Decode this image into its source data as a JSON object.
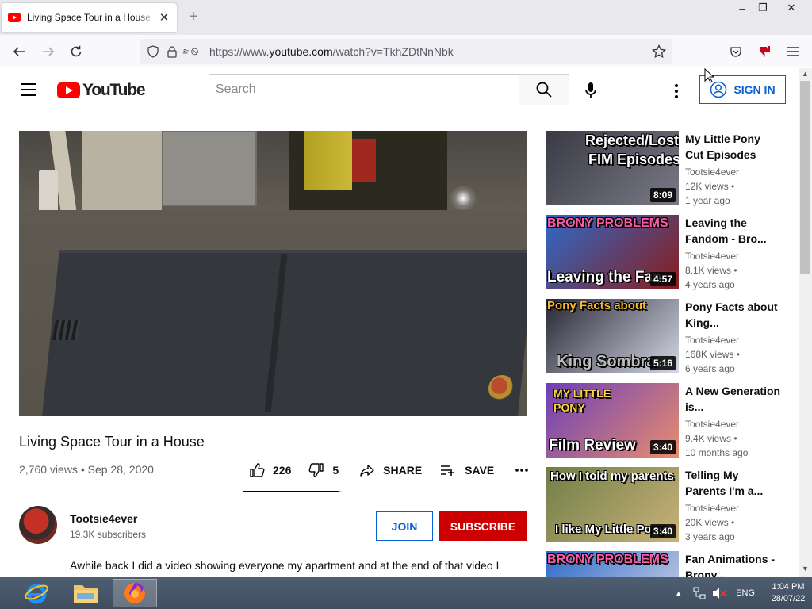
{
  "browser": {
    "tab_title": "Living Space Tour in a House - YouTube",
    "tab_close": "✕",
    "new_tab": "+",
    "url_prefix": "https://www.",
    "url_domain": "youtube.com",
    "url_path": "/watch?v=TkhZDtNnNbk",
    "window_controls": [
      "–",
      "❐",
      "✕"
    ]
  },
  "masthead": {
    "logo_text": "YouTube",
    "search_placeholder": "Search",
    "sign_in_label": "SIGN IN"
  },
  "video": {
    "title": "Living Space Tour in a House",
    "views": "2,760 views",
    "separator": "•",
    "date": "Sep 28, 2020",
    "likes": "226",
    "dislikes": "5",
    "share_label": "SHARE",
    "save_label": "SAVE",
    "like_ratio": 0.978,
    "channel_name": "Tootsie4ever",
    "subscribers": "19.3K subscribers",
    "join_label": "JOIN",
    "subscribe_label": "SUBSCRIBE",
    "description": "Awhile back I did a video showing everyone my apartment and at the end of that video I mentioned I was in the process of buying a house. This is that house and a tour of the whole thing."
  },
  "related": [
    {
      "title": "My Little Pony Cut Episodes",
      "channel": "Tootsie4ever",
      "views": "12K views •",
      "age": "1 year ago",
      "duration": "8:09",
      "thumb_lines": [
        "Rejected/Lost",
        "FIM Episodes"
      ],
      "thumb_colors": [
        "#3a3a44",
        "#7a7a86"
      ]
    },
    {
      "title": "Leaving the Fandom - Bro...",
      "channel": "Tootsie4ever",
      "views": "8.1K views •",
      "age": "4 years ago",
      "duration": "4:57",
      "thumb_lines": [
        "BRONY PROBLEMS",
        "Leaving the Fan"
      ],
      "thumb_colors": [
        "#2c6ac9",
        "#8b1c1c"
      ]
    },
    {
      "title": "Pony Facts about King...",
      "channel": "Tootsie4ever",
      "views": "168K views •",
      "age": "6 years ago",
      "duration": "5:16",
      "thumb_lines": [
        "Pony Facts about",
        "King Sombra"
      ],
      "thumb_colors": [
        "#262633",
        "#d5d8e6"
      ]
    },
    {
      "title": "A New Generation is...",
      "channel": "Tootsie4ever",
      "views": "9.4K views •",
      "age": "10 months ago",
      "duration": "3:40",
      "thumb_lines": [
        "MY LITTLE PONY",
        "Film Review"
      ],
      "thumb_colors": [
        "#6a3fb8",
        "#e98c6d"
      ]
    },
    {
      "title": "Telling My Parents I'm a...",
      "channel": "Tootsie4ever",
      "views": "20K views •",
      "age": "3 years ago",
      "duration": "3:40",
      "thumb_lines": [
        "How I told my parents",
        "I like My Little Pony"
      ],
      "thumb_colors": [
        "#6f7e46",
        "#c9b27a"
      ]
    },
    {
      "title": "Fan Animations - Brony...",
      "channel": "",
      "views": "",
      "age": "",
      "duration": "",
      "thumb_lines": [
        "BRONY PROBLEMS",
        ""
      ],
      "thumb_colors": [
        "#2c6ac9",
        "#d8d8e8"
      ]
    }
  ],
  "taskbar": {
    "language": "ENG",
    "time": "1:04 PM",
    "date": "28/07/22"
  },
  "colors": {
    "brand_red": "#ff0000",
    "link_blue": "#065fd4",
    "subscribe_red": "#cc0000"
  }
}
